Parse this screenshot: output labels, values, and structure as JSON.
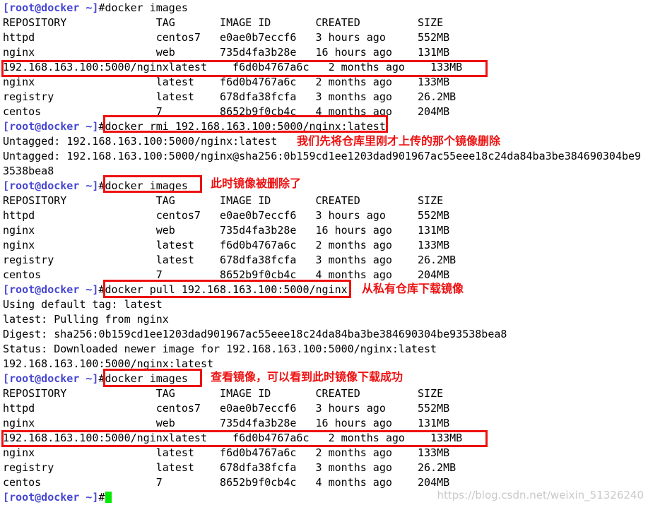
{
  "terminal": {
    "prompt": "[root@docker ~]",
    "hash": "#",
    "columns": [
      "REPOSITORY",
      "TAG",
      "IMAGE ID",
      "CREATED",
      "SIZE"
    ],
    "commands": {
      "images": "docker images",
      "rmi": "docker rmi 192.168.163.100:5000/nginx:latest",
      "pull": "docker pull 192.168.163.100:5000/nginx"
    },
    "header_line": "REPOSITORY              TAG       IMAGE ID       CREATED         SIZE",
    "table1": {
      "rows": [
        {
          "repository": "httpd",
          "tag": "centos7",
          "image_id": "e0ae0b7eccf6",
          "created": "3 hours ago",
          "size": "552MB",
          "highlight": false
        },
        {
          "repository": "nginx",
          "tag": "web",
          "image_id": "735d4fa3b28e",
          "created": "16 hours ago",
          "size": "131MB",
          "highlight": false
        },
        {
          "repository": "192.168.163.100:5000/nginx",
          "tag": "latest",
          "image_id": "f6d0b4767a6c",
          "created": "2 months ago",
          "size": "133MB",
          "highlight": true
        },
        {
          "repository": "nginx",
          "tag": "latest",
          "image_id": "f6d0b4767a6c",
          "created": "2 months ago",
          "size": "133MB",
          "highlight": false
        },
        {
          "repository": "registry",
          "tag": "latest",
          "image_id": "678dfa38fcfa",
          "created": "3 months ago",
          "size": "26.2MB",
          "highlight": false
        },
        {
          "repository": "centos",
          "tag": "7",
          "image_id": "8652b9f0cb4c",
          "created": "4 months ago",
          "size": "204MB",
          "highlight": false
        }
      ]
    },
    "table2": {
      "rows": [
        {
          "repository": "httpd",
          "tag": "centos7",
          "image_id": "e0ae0b7eccf6",
          "created": "3 hours ago",
          "size": "552MB",
          "highlight": false
        },
        {
          "repository": "nginx",
          "tag": "web",
          "image_id": "735d4fa3b28e",
          "created": "16 hours ago",
          "size": "131MB",
          "highlight": false
        },
        {
          "repository": "nginx",
          "tag": "latest",
          "image_id": "f6d0b4767a6c",
          "created": "2 months ago",
          "size": "133MB",
          "highlight": false
        },
        {
          "repository": "registry",
          "tag": "latest",
          "image_id": "678dfa38fcfa",
          "created": "3 months ago",
          "size": "26.2MB",
          "highlight": false
        },
        {
          "repository": "centos",
          "tag": "7",
          "image_id": "8652b9f0cb4c",
          "created": "4 months ago",
          "size": "204MB",
          "highlight": false
        }
      ]
    },
    "table3": {
      "rows": [
        {
          "repository": "httpd",
          "tag": "centos7",
          "image_id": "e0ae0b7eccf6",
          "created": "3 hours ago",
          "size": "552MB",
          "highlight": false
        },
        {
          "repository": "nginx",
          "tag": "web",
          "image_id": "735d4fa3b28e",
          "created": "16 hours ago",
          "size": "131MB",
          "highlight": false
        },
        {
          "repository": "192.168.163.100:5000/nginx",
          "tag": "latest",
          "image_id": "f6d0b4767a6c",
          "created": "2 months ago",
          "size": "133MB",
          "highlight": true
        },
        {
          "repository": "nginx",
          "tag": "latest",
          "image_id": "f6d0b4767a6c",
          "created": "2 months ago",
          "size": "133MB",
          "highlight": false
        },
        {
          "repository": "registry",
          "tag": "latest",
          "image_id": "678dfa38fcfa",
          "created": "3 months ago",
          "size": "26.2MB",
          "highlight": false
        },
        {
          "repository": "centos",
          "tag": "7",
          "image_id": "8652b9f0cb4c",
          "created": "4 months ago",
          "size": "204MB",
          "highlight": false
        }
      ]
    },
    "rmi_output": {
      "untagged_tag": "Untagged: 192.168.163.100:5000/nginx:latest",
      "untagged_digest": "Untagged: 192.168.163.100:5000/nginx@sha256:0b159cd1ee1203dad901967ac55eee18c24da84ba3be384690304be9",
      "untagged_digest_wrap": "3538bea8"
    },
    "pull_output": {
      "using_tag": "Using default tag: latest",
      "pulling": "latest: Pulling from nginx",
      "digest": "Digest: sha256:0b159cd1ee1203dad901967ac55eee18c24da84ba3be384690304be93538bea8",
      "status": "Status: Downloaded newer image for 192.168.163.100:5000/nginx:latest",
      "final_ref": "192.168.163.100:5000/nginx:latest"
    }
  },
  "annotations": {
    "a1": "我们先将仓库里刚才上传的那个镜像删除",
    "a2": "此时镜像被删除了",
    "a3": "从私有仓库下载镜像",
    "a4": "查看镜像，可以看到此时镜像下载成功"
  },
  "watermark": "https://blog.csdn.net/weixin_51326240",
  "colors": {
    "prompt": "#4646d2",
    "annotation_red": "#ee1111",
    "cursor_green": "#00ea00",
    "text": "#000000"
  }
}
